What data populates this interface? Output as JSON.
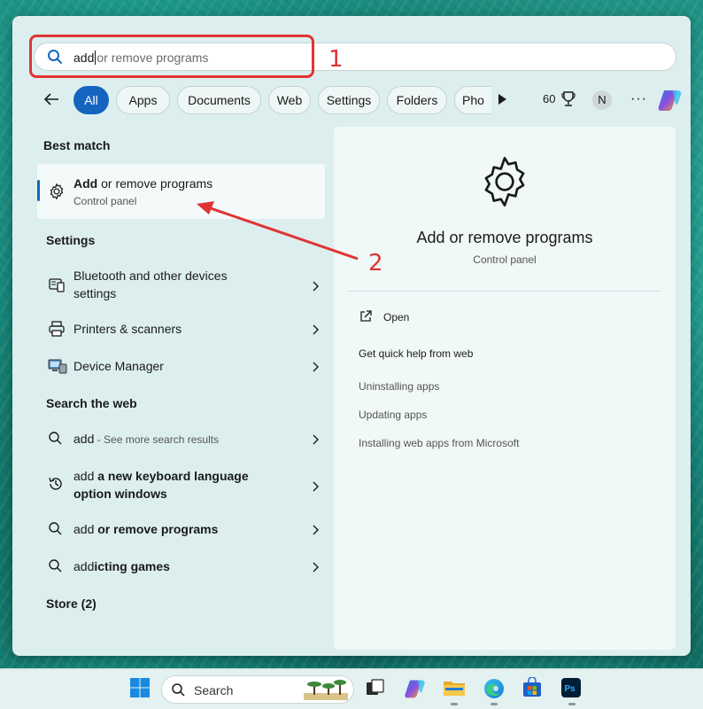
{
  "search": {
    "typed": "add",
    "ghost": "or remove programs"
  },
  "annotations": {
    "color": "#e03434",
    "step1": "1",
    "step2": "2"
  },
  "filters": {
    "chips": [
      "All",
      "Apps",
      "Documents",
      "Web",
      "Settings",
      "Folders",
      "Pho"
    ],
    "active": "All",
    "points": "60",
    "avatar_initial": "N",
    "more": "···"
  },
  "results": {
    "best_match_heading": "Best match",
    "best_match": {
      "title_bold": "Add",
      "title_rest": " or remove programs",
      "subtitle": "Control panel"
    },
    "settings_heading": "Settings",
    "settings_items": [
      {
        "line1": "Bluetooth and other devices",
        "line2": "settings"
      },
      {
        "line1": "Printers & scanners"
      },
      {
        "line1": "Device Manager"
      }
    ],
    "web_heading": "Search the web",
    "web_items": [
      {
        "bold": "add",
        "muted": " - See more search results"
      },
      {
        "plain": "add",
        "bold": " a new keyboard language",
        "line2": "option windows"
      },
      {
        "plain": "add",
        "bold": " or remove programs"
      },
      {
        "plain": "add",
        "bold": "icting games"
      }
    ],
    "store_heading": "Store (2)"
  },
  "detail": {
    "title": "Add or remove programs",
    "subtitle": "Control panel",
    "open_label": "Open",
    "quick_help": "Get quick help from web",
    "links": [
      "Uninstalling apps",
      "Updating apps",
      "Installing web apps from Microsoft"
    ]
  },
  "taskbar": {
    "search_label": "Search",
    "accent": "#1565c0"
  }
}
